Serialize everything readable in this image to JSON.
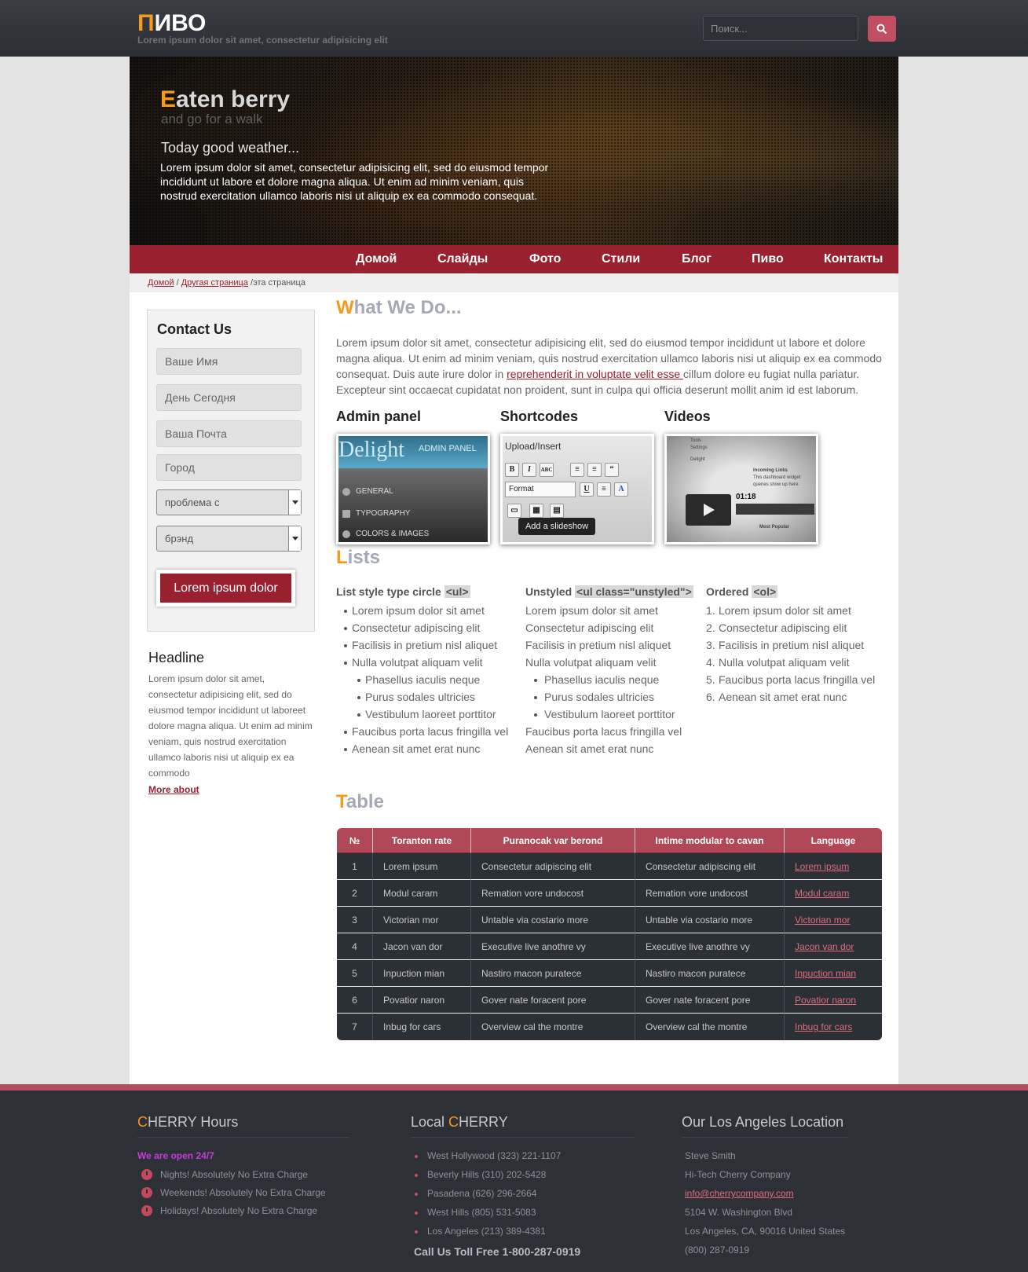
{
  "header": {
    "logo_first": "П",
    "logo_rest": "ИВО",
    "tagline": "Lorem ipsum dolor sit amet, consectetur adipisicing elit",
    "search_placeholder": "Поиск...",
    "search_icon": "search-icon"
  },
  "hero": {
    "title_first": "E",
    "title_rest": "aten berry",
    "subtitle": "and go for a walk",
    "heading": "Today good weather...",
    "text": "Lorem ipsum dolor sit amet, consectetur adipisicing elit, sed do eiusmod tempor incididunt ut labore et dolore magna aliqua. Ut enim ad minim veniam, quis nostrud exercitation ullamco laboris nisi ut aliquip ex ea commodo consequat."
  },
  "nav": [
    "Домой",
    "Слайды",
    "Фото",
    "Стили",
    "Блог",
    "Пиво",
    "Контакты"
  ],
  "breadcrumb": {
    "home": "Домой",
    "sep1": " / ",
    "other": "Другая страница",
    "sep2": " /",
    "current": "эта страница"
  },
  "contact": {
    "title": "Contact Us",
    "name_placeholder": "Ваше Имя",
    "date_placeholder": "День Сегодня",
    "email_placeholder": "Ваша Почта",
    "city_placeholder": "Город",
    "problem_select": "проблема с",
    "brand_select": "брэнд",
    "submit": "Lorem ipsum dolor"
  },
  "sidebar": {
    "headline": "Headline",
    "text": "Lorem ipsum dolor sit amet, consectetur adipisicing elit, sed do eiusmod tempor incididunt ut laboreet dolore magna aliqua. Ut enim ad minim veniam, quis nostrud exercitation ullamco laboris nisi ut aliquip ex ea commodo",
    "more": "More about"
  },
  "what_we_do": {
    "title_first": "W",
    "title_rest": "hat We Do...",
    "text_before": "Lorem ipsum dolor sit amet, consectetur adipisicing elit, sed do eiusmod tempor incididunt ut labore et dolore magna aliqua. Ut enim ad minim veniam, quis nostrud exercitation ullamco laboris nisi ut aliquip ex ea commodo consequat. Duis aute irure dolor in ",
    "link": "reprehenderit in voluptate velit esse ",
    "text_after": "cillum dolore eu fugiat nulla pariatur. Excepteur sint occaecat cupidatat non proident, sunt in culpa qui officia deserunt mollit anim id est laborum."
  },
  "features": {
    "admin": {
      "title": "Admin panel",
      "brand": "Delight",
      "brand_sub": "ADMIN PANEL",
      "items": [
        "GENERAL",
        "TYPOGRAPHY",
        "COLORS & IMAGES"
      ]
    },
    "shortcodes": {
      "title": "Shortcodes",
      "header": "Upload/Insert",
      "format": "Format",
      "tooltip": "Add a slideshow",
      "buttons": [
        "B",
        "I",
        "ABC",
        "U",
        "A"
      ]
    },
    "videos": {
      "title": "Videos",
      "time": "01:18",
      "menu": [
        "Tools",
        "Settings",
        "Delight"
      ],
      "panel_title": "Incoming Links",
      "panel_text": "This dashboard widget queries show up here.",
      "panel_footer": "Most Popular"
    }
  },
  "lists": {
    "title_first": "L",
    "title_rest": "ists",
    "col1": {
      "label": "List style type circle ",
      "code": "<ul>",
      "items": [
        "Lorem ipsum dolor sit amet",
        "Consectetur adipiscing elit",
        "Facilisis in pretium nisl aliquet",
        "Nulla volutpat aliquam velit"
      ],
      "sub": [
        "Phasellus iaculis neque",
        "Purus sodales ultricies",
        "Vestibulum laoreet porttitor"
      ],
      "after": [
        "Faucibus porta lacus fringilla vel",
        "Aenean sit amet erat nunc"
      ]
    },
    "col2": {
      "label": "Unstyled ",
      "code": "<ul class=\"unstyled\">",
      "items": [
        "Lorem ipsum dolor sit amet",
        "Consectetur adipiscing elit",
        "Facilisis in pretium nisl aliquet",
        "Nulla volutpat aliquam velit"
      ],
      "sub": [
        "Phasellus iaculis neque",
        "Purus sodales ultricies",
        "Vestibulum laoreet porttitor"
      ],
      "after": [
        "Faucibus porta lacus fringilla vel",
        "Aenean sit amet erat nunc"
      ]
    },
    "col3": {
      "label": "Ordered ",
      "code": "<ol>",
      "items": [
        "Lorem ipsum dolor sit amet",
        "Consectetur adipiscing elit",
        "Facilisis in pretium nisl aliquet",
        "Nulla volutpat aliquam velit",
        "Faucibus porta lacus fringilla vel",
        "Aenean sit amet erat nunc"
      ]
    }
  },
  "table": {
    "title_first": "T",
    "title_rest": "able",
    "headers": [
      "№",
      "Toranton rate",
      "Puranocak var berond",
      "Intime modular to cavan",
      "Language"
    ],
    "rows": [
      [
        "1",
        "Lorem ipsum",
        "Consectetur adipiscing elit",
        "Consectetur adipiscing elit",
        "Lorem ipsum"
      ],
      [
        "2",
        "Modul caram",
        "Remation vore undocost",
        "Remation vore undocost",
        "Modul caram"
      ],
      [
        "3",
        "Victorian mor",
        "Untable via costario more",
        "Untable via costario more",
        "Victorian mor"
      ],
      [
        "4",
        "Jacon van dor",
        "Executive live anothre vy",
        "Executive live anothre vy",
        "Jacon van dor"
      ],
      [
        "5",
        "Inpuction mian",
        "Nastiro macon puratece",
        "Nastiro macon puratece",
        "Inpuction mian"
      ],
      [
        "6",
        "Povatior naron",
        "Gover nate foracent pore",
        "Gover nate foracent pore",
        "Povatior naron"
      ],
      [
        "7",
        "Inbug for cars",
        "Overview cal the montre",
        "Overview cal the montre",
        "Inbug for cars"
      ]
    ]
  },
  "footer": {
    "hours": {
      "title_first": "C",
      "title_rest": "HERRY Hours",
      "open": "We are open 24/7",
      "items": [
        "Nights! Absolutely No Extra Charge",
        "Weekends! Absolutely No Extra Charge",
        "Holidays! Absolutely No Extra Charge"
      ]
    },
    "local": {
      "title_pre": "Local ",
      "title_first": "C",
      "title_rest": "HERRY",
      "items": [
        "West Hollywood (323) 221-1107",
        "Beverly Hills (310) 202-5428",
        "Pasadena (626) 296-2664",
        "West Hills (805) 531-5083",
        "Los Angeles (213) 389-4381"
      ],
      "tollfree": "Call Us Toll Free 1-800-287-0919"
    },
    "location": {
      "title": "Our Los Angeles Location",
      "lines": [
        "Steve Smith",
        "Hi-Tech Cherry Company",
        "info@cherrycompany.com",
        "5104 W. Washington Blvd",
        "Los Angeles, CA, 90016 United States",
        "(800) 287-0919"
      ]
    }
  },
  "colors": {
    "accent": "#99202e",
    "orange": "#f59a1b",
    "table_header": "#b04858",
    "footer_bg": "#2d3037"
  }
}
